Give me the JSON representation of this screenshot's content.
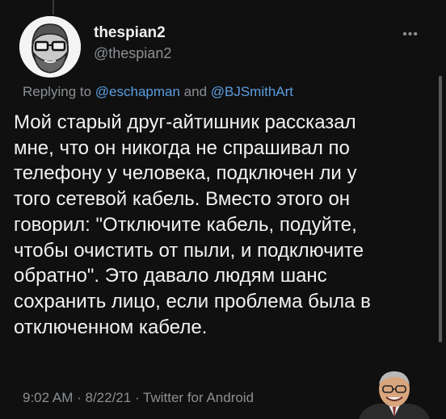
{
  "author": {
    "display_name": "thespian2",
    "handle": "@thespian2",
    "avatar_icon": "bearded-man-glasses-avatar"
  },
  "menu": {
    "more_label": "•••"
  },
  "reply": {
    "prefix": "Replying to ",
    "mention1": "@eschapman",
    "conj": " and ",
    "mention2": "@BJSmithArt"
  },
  "tweet": {
    "text": "Мой старый друг-айтишник рассказал\nмне, что он никогда не спрашивал по\nтелефону у человека, подключен ли у\nтого сетевой кабель. Вместо этого он\nговорил: \"Отключите кабель, подуйте,\nчтобы очистить от пыли, и подключите\nобратно\". Это давало людям шанс\nсохранить лицо, если проблема была в\nотключенном кабеле."
  },
  "meta": {
    "time": "9:02 AM",
    "sep1": " · ",
    "date": "8/22/21",
    "sep2": " · ",
    "source": "Twitter for Android"
  },
  "colors": {
    "background": "#101010",
    "text": "#f2f2f2",
    "secondary": "#8b8f93",
    "link": "#5b9ee0"
  }
}
